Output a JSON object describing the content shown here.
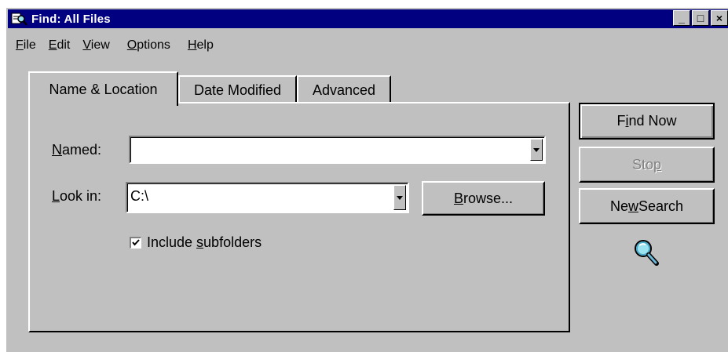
{
  "window": {
    "title": "Find: All Files",
    "controls": {
      "minimize": "_",
      "maximize": "□",
      "close": "×"
    }
  },
  "menu": [
    {
      "pre": "",
      "u": "F",
      "post": "ile"
    },
    {
      "pre": "",
      "u": "E",
      "post": "dit"
    },
    {
      "pre": "",
      "u": "V",
      "post": "iew"
    },
    {
      "pre": "",
      "u": "O",
      "post": "ptions"
    },
    {
      "pre": "",
      "u": "H",
      "post": "elp"
    }
  ],
  "tabs": [
    {
      "label": "Name & Location",
      "active": true
    },
    {
      "label": "Date Modified",
      "active": false
    },
    {
      "label": "Advanced",
      "active": false
    }
  ],
  "form": {
    "named_label": {
      "pre": "",
      "u": "N",
      "post": "amed:"
    },
    "named_value": "",
    "lookin_label": {
      "pre": "",
      "u": "L",
      "post": "ook in:"
    },
    "lookin_value": "C:\\",
    "browse_label": {
      "pre": "",
      "u": "B",
      "post": "rowse..."
    },
    "include_label": {
      "pre": "Include ",
      "u": "s",
      "post": "ubfolders"
    },
    "include_checked": true
  },
  "buttons": {
    "find_now": {
      "pre": "F",
      "u": "i",
      "post": "nd Now"
    },
    "stop": {
      "pre": "Sto",
      "u": "p",
      "post": ""
    },
    "new_search": {
      "pre": "Ne",
      "u": "w",
      "post": " Search"
    }
  },
  "icons": {
    "title": "find-files-icon",
    "search": "magnifier-icon"
  }
}
